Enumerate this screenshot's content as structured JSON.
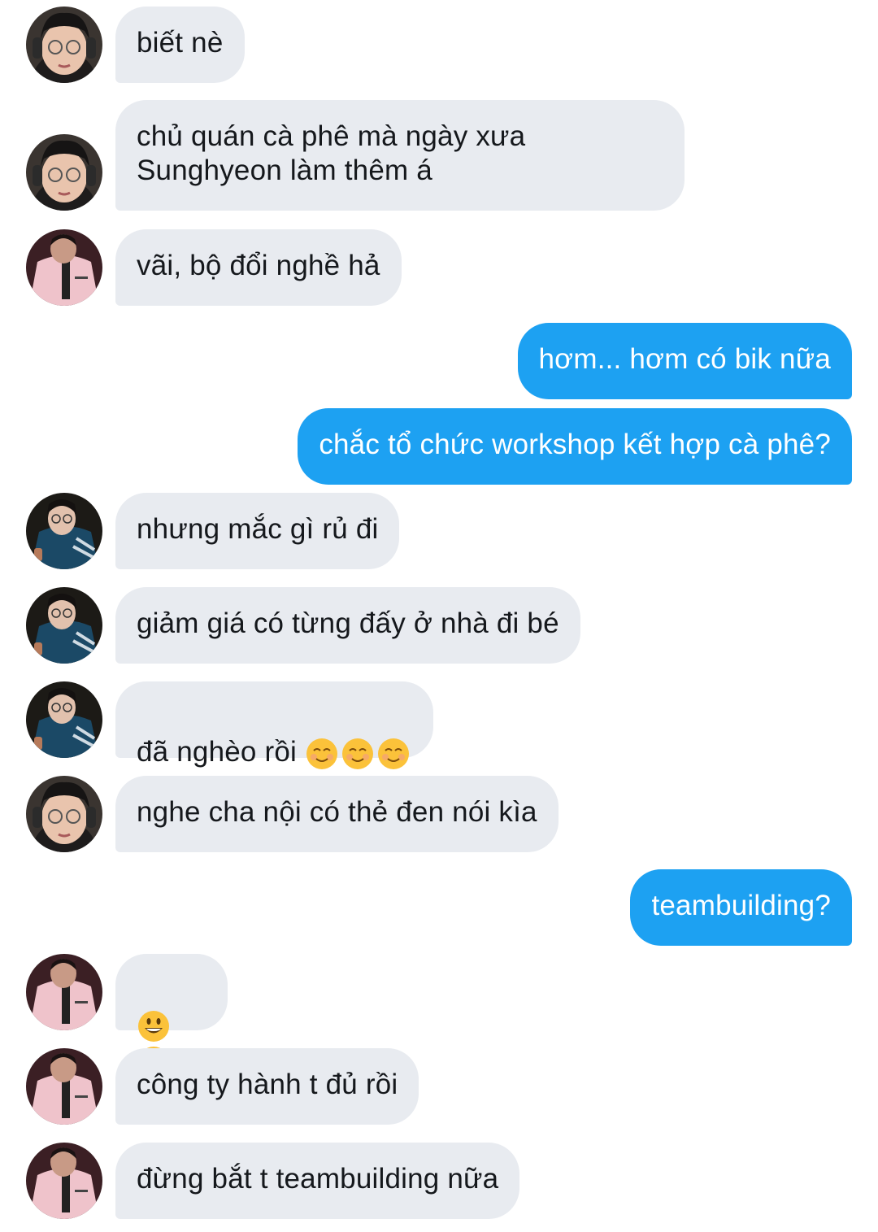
{
  "conversation": {
    "messages": [
      {
        "sender": "user-a",
        "avatar": "boy-headphones-glasses-avatar",
        "text": "biết nè"
      },
      {
        "sender": "user-a",
        "avatar": "boy-headphones-glasses-avatar",
        "text": "chủ quán cà phê mà ngày xưa\nSunghyeon làm thêm á"
      },
      {
        "sender": "user-b",
        "avatar": "pink-jacket-avatar",
        "text": "vãi, bộ đổi nghề hả"
      },
      {
        "sender": "me",
        "text": "hơm... hơm có bik nữa"
      },
      {
        "sender": "me",
        "text": "chắc tổ chức workshop kết hợp cà phê?"
      },
      {
        "sender": "user-c",
        "avatar": "blue-jacket-glasses-avatar",
        "text": "nhưng mắc gì rủ đi"
      },
      {
        "sender": "user-c",
        "avatar": "blue-jacket-glasses-avatar",
        "text": "giảm giá có từng đấy ở nhà đi bé"
      },
      {
        "sender": "user-c",
        "avatar": "blue-jacket-glasses-avatar",
        "text": "đã nghèo rồi ",
        "emoji": "☺☺☺"
      },
      {
        "sender": "user-a",
        "avatar": "boy-headphones-glasses-avatar",
        "text": "nghe cha nội có thẻ đen nói kìa"
      },
      {
        "sender": "me",
        "text": "teambuilding?"
      },
      {
        "sender": "user-b",
        "avatar": "pink-jacket-avatar",
        "text": "",
        "emoji": "😃😃"
      },
      {
        "sender": "user-b",
        "avatar": "pink-jacket-avatar",
        "text": "công ty hành t đủ rồi"
      },
      {
        "sender": "user-b",
        "avatar": "pink-jacket-avatar",
        "text": "đừng bắt t teambuilding nữa"
      }
    ]
  },
  "colors": {
    "incoming_bubble": "#e8ebf0",
    "outgoing_bubble": "#1da1f2",
    "incoming_text": "#15181c",
    "outgoing_text": "#ffffff"
  }
}
